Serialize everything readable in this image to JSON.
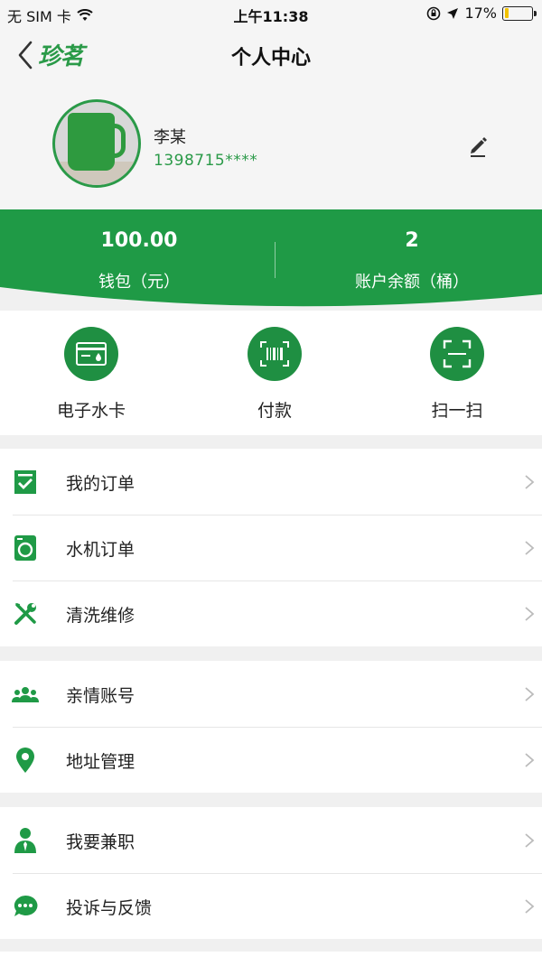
{
  "status_bar": {
    "carrier": "无 SIM 卡",
    "time": "上午11:38",
    "battery_text": "17%",
    "battery_level": 0.17
  },
  "nav": {
    "logo_text": "珍茗",
    "title": "个人中心"
  },
  "profile": {
    "name": "李某",
    "phone": "1398715****"
  },
  "stats": [
    {
      "value": "100.00",
      "label": "钱包（元）"
    },
    {
      "value": "2",
      "label": "账户余额（桶）"
    }
  ],
  "quick_actions": [
    {
      "label": "电子水卡",
      "icon": "water-card-icon"
    },
    {
      "label": "付款",
      "icon": "barcode-icon"
    },
    {
      "label": "扫一扫",
      "icon": "scan-icon"
    }
  ],
  "menu_groups": [
    [
      {
        "label": "我的订单",
        "icon": "order-check-icon"
      },
      {
        "label": "水机订单",
        "icon": "washer-icon"
      },
      {
        "label": "清洗维修",
        "icon": "tools-icon"
      }
    ],
    [
      {
        "label": "亲情账号",
        "icon": "family-icon"
      },
      {
        "label": "地址管理",
        "icon": "location-pin-icon"
      }
    ],
    [
      {
        "label": "我要兼职",
        "icon": "person-tie-icon"
      },
      {
        "label": "投诉与反馈",
        "icon": "chat-bubble-icon"
      }
    ]
  ],
  "colors": {
    "brand_green": "#2a9a48",
    "dark_green": "#1f8f42",
    "background": "#f0f0f0"
  }
}
